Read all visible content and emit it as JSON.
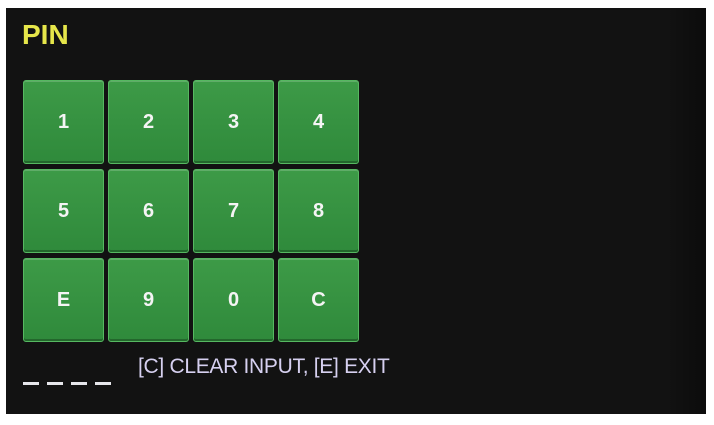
{
  "header": {
    "title": "PIN"
  },
  "keypad": {
    "keys": [
      {
        "label": "1"
      },
      {
        "label": "2"
      },
      {
        "label": "3"
      },
      {
        "label": "4"
      },
      {
        "label": "5"
      },
      {
        "label": "6"
      },
      {
        "label": "7"
      },
      {
        "label": "8"
      },
      {
        "label": "E"
      },
      {
        "label": "9"
      },
      {
        "label": "0"
      },
      {
        "label": "C"
      }
    ]
  },
  "pin_entry": {
    "length": 4,
    "entered": 0
  },
  "footer": {
    "hint": "[C] CLEAR INPUT, [E] EXIT"
  },
  "colors": {
    "background": "#121212",
    "title": "#e6e64a",
    "key": "#3d9a47",
    "hint": "#d6d0f0"
  }
}
